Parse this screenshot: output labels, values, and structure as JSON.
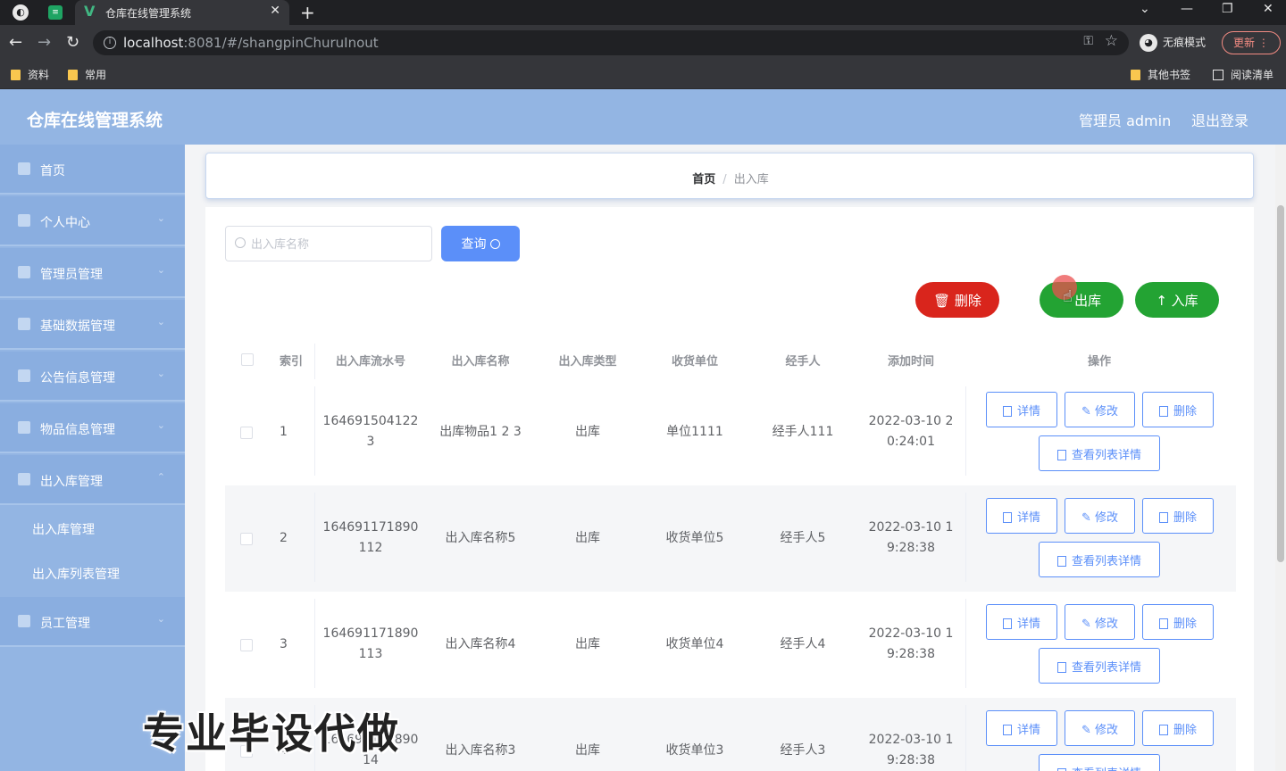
{
  "browser": {
    "tab_title": "仓库在线管理系统",
    "url_host": "localhost",
    "url_path": ":8081/#/shangpinChuruInout",
    "incognito_label": "无痕模式",
    "update_label": "更新",
    "bookmarks": [
      "资料",
      "常用"
    ],
    "bookmarks_right": [
      "其他书签",
      "阅读清单"
    ]
  },
  "header": {
    "title": "仓库在线管理系统",
    "user": "管理员 admin",
    "logout": "退出登录"
  },
  "sidebar": {
    "items": [
      {
        "label": "首页"
      },
      {
        "label": "个人中心"
      },
      {
        "label": "管理员管理"
      },
      {
        "label": "基础数据管理"
      },
      {
        "label": "公告信息管理"
      },
      {
        "label": "物品信息管理"
      },
      {
        "label": "出入库管理"
      },
      {
        "label": "员工管理"
      }
    ],
    "sub_items": [
      "出入库管理",
      "出入库列表管理"
    ]
  },
  "breadcrumb": {
    "home": "首页",
    "separator": "/",
    "current": "出入库"
  },
  "search": {
    "placeholder": "出入库名称",
    "query_label": "查询"
  },
  "actions": {
    "delete": "删除",
    "out": "出库",
    "in": "入库"
  },
  "table": {
    "columns": [
      "索引",
      "出入库流水号",
      "出入库名称",
      "出入库类型",
      "收货单位",
      "经手人",
      "添加时间",
      "操作"
    ],
    "row_buttons": {
      "detail": "详情",
      "edit": "修改",
      "delete": "删除",
      "list_detail": "查看列表详情"
    },
    "rows": [
      {
        "index": "1",
        "serial_a": "164691504122",
        "serial_b": "3",
        "name": "出库物品1 2 3",
        "type": "出库",
        "unit": "单位1111",
        "handler": "经手人111",
        "time_a": "2022-03-10 2",
        "time_b": "0:24:01"
      },
      {
        "index": "2",
        "serial_a": "164691171890",
        "serial_b": "112",
        "name": "出入库名称5",
        "type": "出库",
        "unit": "收货单位5",
        "handler": "经手人5",
        "time_a": "2022-03-10 1",
        "time_b": "9:28:38"
      },
      {
        "index": "3",
        "serial_a": "164691171890",
        "serial_b": "113",
        "name": "出入库名称4",
        "type": "出库",
        "unit": "收货单位4",
        "handler": "经手人4",
        "time_a": "2022-03-10 1",
        "time_b": "9:28:38"
      },
      {
        "index": "4",
        "serial_a": "164691171890",
        "serial_b": "14",
        "name": "出入库名称3",
        "type": "出库",
        "unit": "收货单位3",
        "handler": "经手人3",
        "time_a": "2022-03-10 1",
        "time_b": "9:28:38"
      }
    ]
  },
  "watermark": "专业毕设代做"
}
